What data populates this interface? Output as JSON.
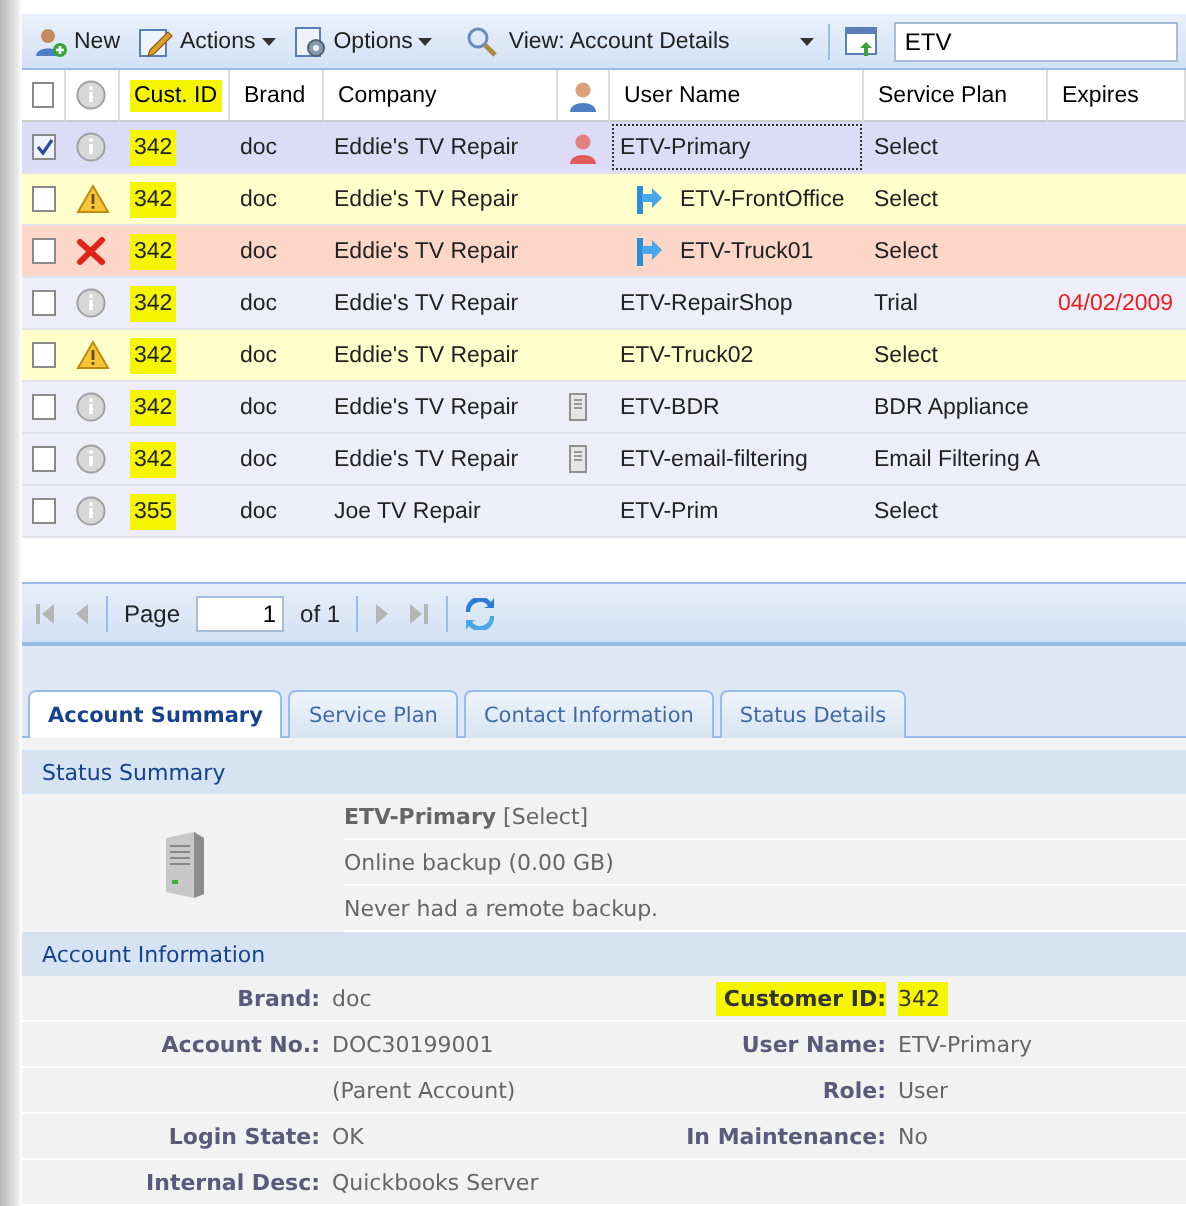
{
  "toolbar": {
    "buttons": [
      {
        "label": "New",
        "kind": "new",
        "menu": false
      },
      {
        "label": "Actions",
        "kind": "actions",
        "menu": true
      },
      {
        "label": "Options",
        "kind": "options",
        "menu": true
      }
    ],
    "view": {
      "label": "View: Account Details"
    },
    "search": {
      "value": "ETV"
    }
  },
  "table": {
    "all_checked": false,
    "columns": [
      {
        "label": "Cust. ID",
        "highlighted": true
      },
      {
        "label": "Brand",
        "highlighted": false
      },
      {
        "label": "Company",
        "highlighted": false
      },
      {
        "label": "User Name",
        "highlighted": false
      },
      {
        "label": "Service Plan",
        "highlighted": false
      },
      {
        "label": "Expires",
        "highlighted": false
      }
    ],
    "rows": [
      {
        "checked": true,
        "selected": true,
        "status_icon": {
          "kind": "info"
        },
        "cust_id": "342",
        "brand": "doc",
        "company": "Eddie's TV Repair",
        "user_icon": {
          "kind": "person"
        },
        "child": false,
        "user_name": "ETV-Primary",
        "plan": "Select"
      },
      {
        "checked": false,
        "selected": false,
        "status_icon": {
          "kind": "warning"
        },
        "cust_id": "342",
        "brand": "doc",
        "company": "Eddie's TV Repair",
        "child": true,
        "user_name": "ETV-FrontOffice",
        "plan": "Select"
      },
      {
        "checked": false,
        "selected": false,
        "status_icon": {
          "kind": "error"
        },
        "cust_id": "342",
        "brand": "doc",
        "company": "Eddie's TV Repair",
        "child": true,
        "user_name": "ETV-Truck01",
        "plan": "Select"
      },
      {
        "checked": false,
        "selected": false,
        "status_icon": {
          "kind": "info"
        },
        "cust_id": "342",
        "brand": "doc",
        "company": "Eddie's TV Repair",
        "child": false,
        "user_name": "ETV-RepairShop",
        "plan": "Trial",
        "expires": "04/02/2009",
        "expired": true
      },
      {
        "checked": false,
        "selected": false,
        "status_icon": {
          "kind": "warning"
        },
        "cust_id": "342",
        "brand": "doc",
        "company": "Eddie's TV Repair",
        "child": false,
        "user_name": "ETV-Truck02",
        "plan": "Select"
      },
      {
        "checked": false,
        "selected": false,
        "status_icon": {
          "kind": "info"
        },
        "cust_id": "342",
        "brand": "doc",
        "company": "Eddie's TV Repair",
        "user_icon": {
          "kind": "server"
        },
        "child": false,
        "user_name": "ETV-BDR",
        "plan": "BDR Appliance"
      },
      {
        "checked": false,
        "selected": false,
        "status_icon": {
          "kind": "info"
        },
        "cust_id": "342",
        "brand": "doc",
        "company": "Eddie's TV Repair",
        "user_icon": {
          "kind": "server"
        },
        "child": false,
        "user_name": "ETV-email-filtering",
        "plan": "Email Filtering A"
      },
      {
        "checked": false,
        "selected": false,
        "status_icon": {
          "kind": "info"
        },
        "cust_id": "355",
        "brand": "doc",
        "company": "Joe TV Repair",
        "child": false,
        "user_name": "ETV-Prim",
        "plan": "Select"
      }
    ]
  },
  "pager": {
    "first_disabled": true,
    "prev_disabled": true,
    "next_disabled": true,
    "last_disabled": true,
    "page_label": "Page",
    "page": "1",
    "of": "of 1"
  },
  "tabs": [
    {
      "label": "Account Summary",
      "selected": true
    },
    {
      "label": "Service Plan",
      "selected": false
    },
    {
      "label": "Contact Information",
      "selected": false
    },
    {
      "label": "Status Details",
      "selected": false
    }
  ],
  "status_summary": {
    "title": "Status Summary",
    "lines": [
      "**ETV-Primary** [Select]",
      "Online backup (0.00 GB)",
      "Never had a remote backup."
    ]
  },
  "account_info": {
    "title": "Account Information",
    "rows": [
      {
        "left": {
          "label": "Brand:",
          "value": "doc",
          "highlighted": false
        },
        "right": {
          "label": "Customer ID:",
          "value": "342",
          "highlighted": true
        }
      },
      {
        "left": {
          "label": "Account No.:",
          "value": "DOC30199001",
          "highlighted": false
        },
        "right": {
          "label": "User Name:",
          "value": "ETV-Primary",
          "highlighted": false
        }
      },
      {
        "left": {
          "value": "(Parent Account)",
          "highlighted": false
        },
        "right": {
          "label": "Role:",
          "value": "User",
          "highlighted": false
        }
      },
      {
        "left": {
          "label": "Login State:",
          "value": "OK",
          "highlighted": false
        },
        "right": {
          "label": "In Maintenance:",
          "value": "No",
          "highlighted": false
        }
      },
      {
        "left": {
          "label": "Internal Desc:",
          "value": "Quickbooks Server",
          "highlighted": false
        },
        "right": null
      }
    ]
  }
}
